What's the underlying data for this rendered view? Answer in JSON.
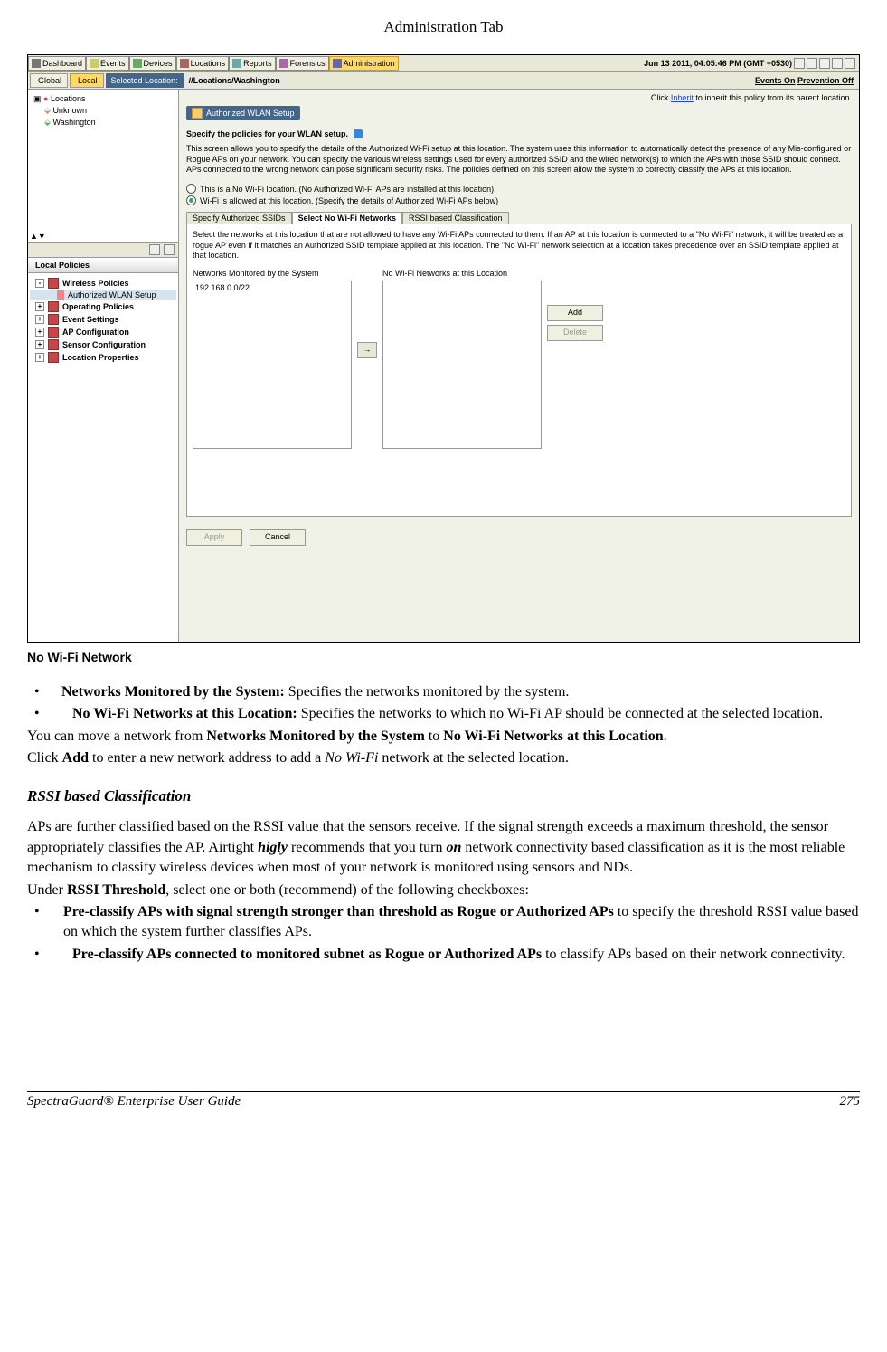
{
  "header": {
    "title": "Administration Tab"
  },
  "app": {
    "nav_tabs": {
      "dashboard": "Dashboard",
      "events": "Events",
      "devices": "Devices",
      "locations": "Locations",
      "reports": "Reports",
      "forensics": "Forensics",
      "administration": "Administration"
    },
    "timestamp": "Jun 13 2011, 04:05:46 PM (GMT +0530)",
    "scope_tabs": {
      "global": "Global",
      "local": "Local"
    },
    "selected_location_label": "Selected Location:",
    "selected_location_value": "//Locations/Washington",
    "events_status_on": "Events On",
    "events_status_off": "Prevention Off",
    "location_tree": {
      "root": "Locations",
      "unknown": "Unknown",
      "washington": "Washington"
    },
    "policies_panel_title": "Local Policies",
    "policies": {
      "wireless": "Wireless Policies",
      "authorized_wlan": "Authorized WLAN Setup",
      "operating": "Operating Policies",
      "event_settings": "Event Settings",
      "ap_config": "AP Configuration",
      "sensor_config": "Sensor Configuration",
      "location_props": "Location Properties"
    },
    "inherit_pre": "Click ",
    "inherit_link": "Inherit",
    "inherit_post": " to inherit this policy from its parent location.",
    "panel_title": "Authorized WLAN Setup",
    "policy_intro": "Specify the policies for your WLAN setup.",
    "desc": "This screen allows you to specify the details of the Authorized Wi-Fi setup at this location. The system uses this information to automatically detect the presence of any Mis-configured or Rogue APs on your network. You can specify the various wireless settings used for every authorized SSID and the wired network(s) to which the APs with those SSID should connect. APs connected to the wrong network can pose significant security risks. The policies defined on this screen allow the system to correctly classify the APs at this location.",
    "radio1": "This is a No Wi-Fi location. (No Authorized Wi-Fi APs are installed at this location)",
    "radio2": "Wi-Fi is allowed at this location. (Specify the details of Authorized Wi-Fi APs below)",
    "inner_tabs": {
      "ssids": "Specify Authorized SSIDs",
      "nowifi": "Select No Wi-Fi Networks",
      "rssi": "RSSI based Classification"
    },
    "panel_desc": "Select the networks at this location that are not allowed to have any Wi-Fi APs connected to them. If an AP at this location is connected to a \"No Wi-Fi\" network, it will be treated as a rogue AP even if it matches an Authorized SSID template applied at this location. The \"No Wi-Fi\" network selection at a location takes precedence over an SSID template applied at that location.",
    "list1_label": "Networks Monitored by the System",
    "list1_item": "192.168.0.0/22",
    "list2_label": "No Wi-Fi Networks at this Location",
    "btn_add": "Add",
    "btn_delete": "Delete",
    "btn_apply": "Apply",
    "btn_cancel": "Cancel",
    "arrow": "→"
  },
  "caption": "No Wi-Fi Network",
  "doc": {
    "b1_strong": "Networks Monitored by the System:",
    "b1_rest": " Specifies the networks monitored by the system.",
    "b2_strong": "No Wi-Fi Networks at this Location:",
    "b2_rest": " Specifies the networks to which no Wi-Fi AP should be connected at the selected location.",
    "p1a": "You can move a network from ",
    "p1b": "Networks Monitored by the System",
    "p1c": " to ",
    "p1d": "No Wi-Fi Networks at this Location",
    "p1e": ".",
    "p2a": "Click ",
    "p2b": "Add",
    "p2c": " to enter a new network address to add a ",
    "p2d": "No Wi-Fi",
    "p2e": " network at the selected location.",
    "sub": "RSSI based Classification",
    "p3a": "APs are further classified based on the RSSI value that the sensors receive. If the signal strength exceeds a maximum threshold, the sensor appropriately classifies the AP. Airtight ",
    "p3b": "higly",
    "p3c": " recommends that you turn ",
    "p3d": "on",
    "p3e": " network connectivity based classification as it is the most reliable mechanism to classify wireless devices when most of your network is monitored using sensors and NDs.",
    "p4a": "Under ",
    "p4b": "RSSI Threshold",
    "p4c": ", select one or both (recommend) of the following checkboxes:",
    "b3_strong": "Pre-classify APs with signal strength stronger than threshold as Rogue or Authorized APs",
    "b3_rest": " to specify the threshold RSSI value based on which the system further classifies APs.",
    "b4_strong": "Pre-classify APs connected to monitored subnet as Rogue or Authorized APs",
    "b4_rest": " to classify APs based on their network connectivity."
  },
  "footer": {
    "product": "SpectraGuard® Enterprise User Guide",
    "page": "275"
  }
}
